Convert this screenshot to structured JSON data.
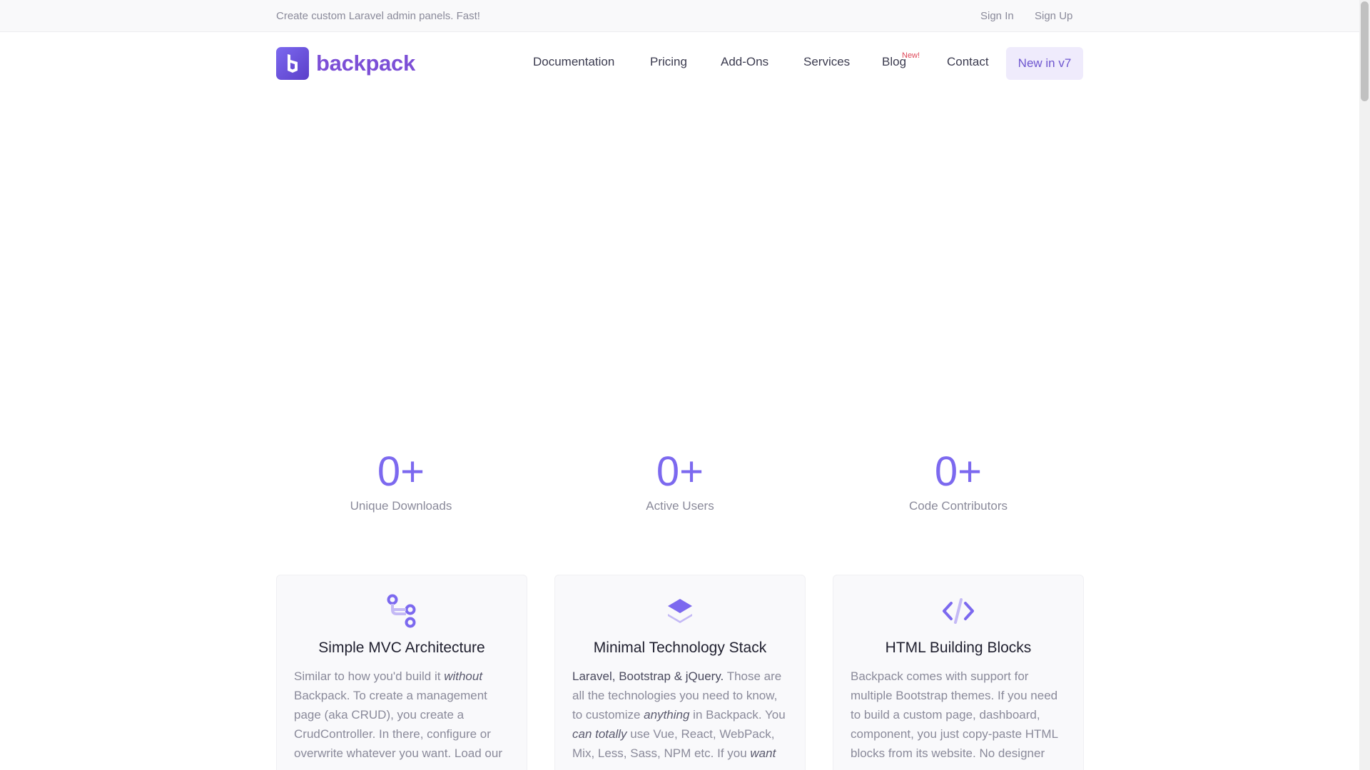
{
  "topbar": {
    "tagline": "Create custom Laravel admin panels. Fast!",
    "sign_in": "Sign In",
    "sign_up": "Sign Up"
  },
  "brand": {
    "name": "backpack",
    "logo_icon": "backpack-logo-icon"
  },
  "nav": {
    "documentation": "Documentation",
    "pricing": "Pricing",
    "addons": "Add-Ons",
    "services": "Services",
    "blog": "Blog",
    "blog_badge": "New!",
    "contact": "Contact",
    "new_in_v7": "New in v7"
  },
  "stats": [
    {
      "value": "0+",
      "label": "Unique Downloads"
    },
    {
      "value": "0+",
      "label": "Active Users"
    },
    {
      "value": "0+",
      "label": "Code Contributors"
    }
  ],
  "features": [
    {
      "icon": "git-branch-icon",
      "title": "Simple MVC Architecture",
      "p1": "Similar to how you'd build it ",
      "em1": "without",
      "p2": " Backpack. To create a management page (aka CRUD), you create a CrudController. In there, configure or overwrite whatever you want. Load our"
    },
    {
      "icon": "layers-icon",
      "title": "Minimal Technology Stack",
      "strong1": "Laravel, Bootstrap & jQuery.",
      "p1": " Those are all the technologies you need to know, to customize ",
      "em1": "anything",
      "p2": " in Backpack. You ",
      "em2": "can totally",
      "p3": " use Vue, React, WebPack, Mix, Less, Sass, NPM etc. If you ",
      "em3": "want"
    },
    {
      "icon": "code-icon",
      "title": "HTML Building Blocks",
      "p1": "Backpack comes with support for multiple Bootstrap themes. If you need to build a custom page, dashboard, component, you just copy-paste HTML blocks from its website. No designer"
    }
  ],
  "colors": {
    "accent": "#7c69ef",
    "brand_text": "#7c4fd6",
    "badge_red": "#df4759"
  }
}
